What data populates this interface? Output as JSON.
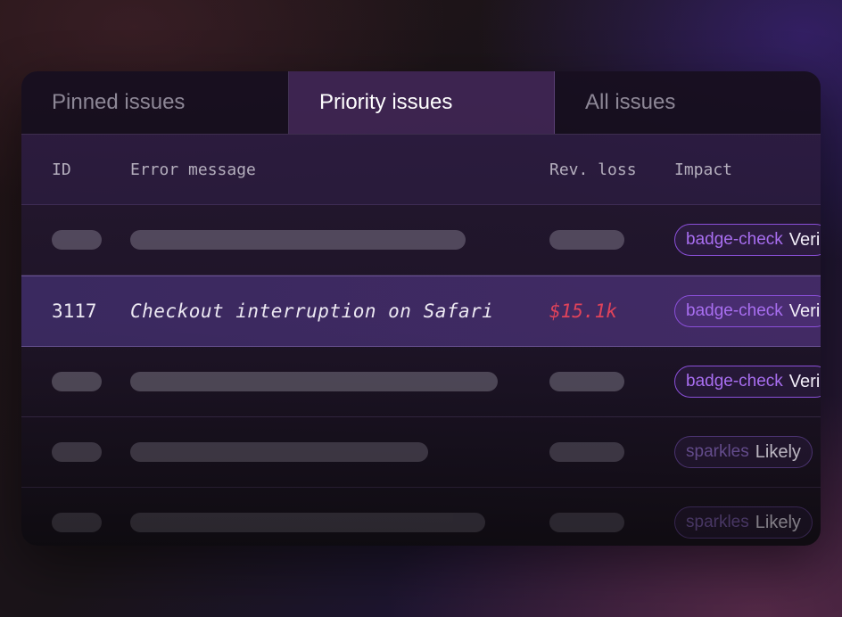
{
  "tabs": [
    {
      "label": "Pinned issues"
    },
    {
      "label": "Priority issues"
    },
    {
      "label": "All issues"
    }
  ],
  "table": {
    "columns": [
      "ID",
      "Error message",
      "Rev. loss",
      "Impact"
    ],
    "selected_row": {
      "id": "3117",
      "message": "Checkout interruption on Safari",
      "rev_loss": "$15.1k"
    },
    "impact_badges": [
      {
        "icon": "badge-check",
        "label": "Veri"
      },
      {
        "icon": "badge-check",
        "label": "Veri"
      },
      {
        "icon": "badge-check",
        "label": "Veri"
      },
      {
        "icon": "sparkles",
        "label": "Likely"
      },
      {
        "icon": "sparkles",
        "label": "Likely"
      }
    ]
  }
}
